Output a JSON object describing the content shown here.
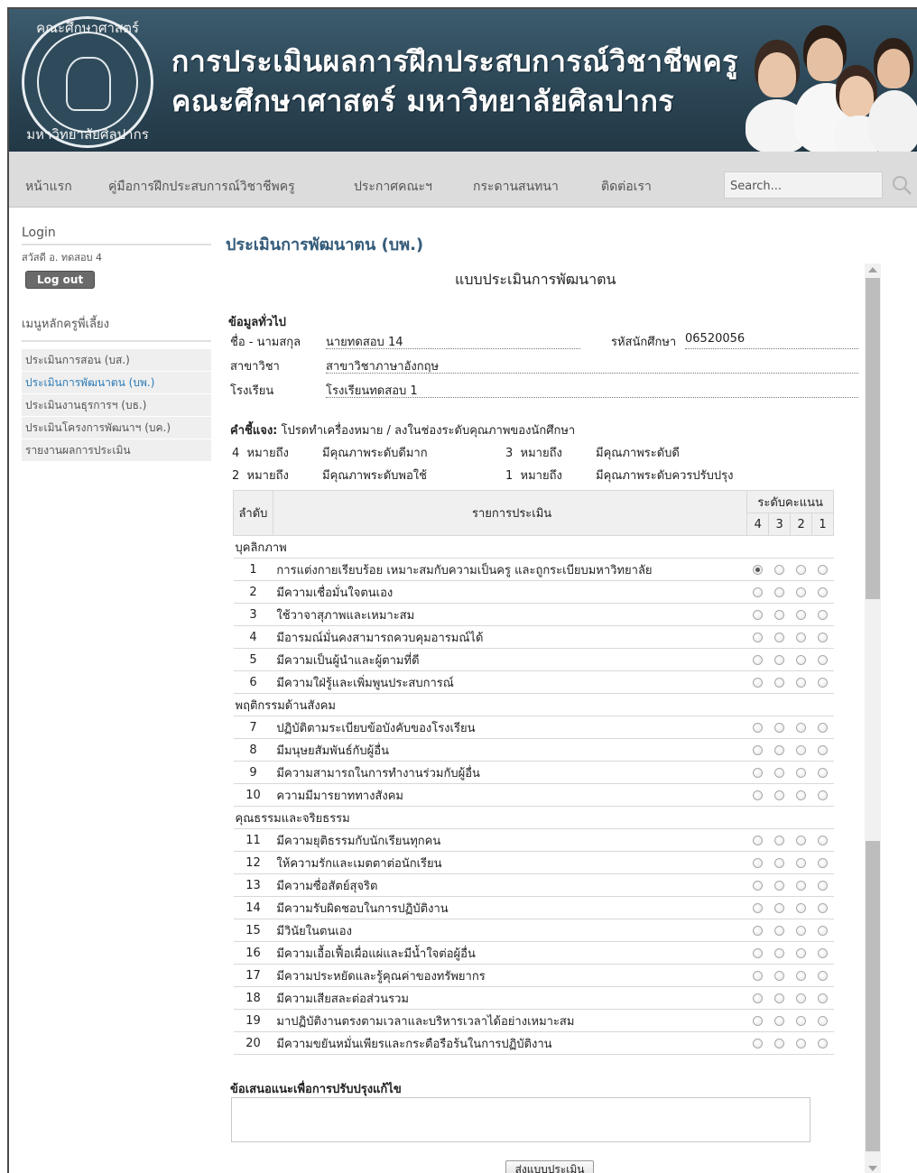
{
  "banner": {
    "line1": "การประเมินผลการฝึกประสบการณ์วิชาชีพครู",
    "line2": "คณะศึกษาศาสตร์ มหาวิทยาลัยศิลปากร",
    "seal_top": "คณะศึกษาศาสตร์",
    "seal_bottom": "มหาวิทยาลัยศิลปากร"
  },
  "nav": {
    "items": [
      "หน้าแรก",
      "คู่มือการฝึกประสบการณ์วิชาชีพครู",
      "ประกาศคณะฯ",
      "กระดานสนทนา",
      "ติดต่อเรา"
    ],
    "search_placeholder": "Search..."
  },
  "sidebar": {
    "login_heading": "Login",
    "greeting": "สวัสดี อ. ทดสอบ 4",
    "logout": "Log out",
    "menu_heading": "เมนูหลักครูพี่เลี้ยง",
    "menu": [
      "ประเมินการสอน (บส.)",
      "ประเมินการพัฒนาตน (บพ.)",
      "ประเมินงานธุรการฯ (บธ.)",
      "ประเมินโครงการพัฒนาฯ (บค.)",
      "รายงานผลการประเมิน"
    ]
  },
  "main": {
    "title": "ประเมินการพัฒนาตน (บพ.)",
    "form_title": "แบบประเมินการพัฒนาตน",
    "general_heading": "ข้อมูลทั่วไป",
    "name_label": "ชื่อ - นามสกุล",
    "name_value": "นายทดสอบ 14",
    "student_id_label": "รหัสนักศึกษา",
    "student_id_value": "06520056",
    "major_label": "สาขาวิชา",
    "major_value": "สาขาวิชาภาษาอังกฤษ",
    "school_label": "โรงเรียน",
    "school_value": "โรงเรียนทดสอบ 1",
    "instruction_bold": "คำชี้แจง:",
    "instruction_text": " โปรดทำเครื่องหมาย / ลงในช่องระดับคุณภาพของนักศึกษา",
    "legend": [
      {
        "num": "4",
        "means": "หมายถึง",
        "desc": "มีคุณภาพระดับดีมาก"
      },
      {
        "num": "3",
        "means": "หมายถึง",
        "desc": "มีคุณภาพระดับดี"
      },
      {
        "num": "2",
        "means": "หมายถึง",
        "desc": "มีคุณภาพระดับพอใช้"
      },
      {
        "num": "1",
        "means": "หมายถึง",
        "desc": "มีคุณภาพระดับควรปรับปรุง"
      }
    ],
    "table": {
      "col_order": "ลำดับ",
      "col_item": "รายการประเมิน",
      "col_score": "ระดับคะแนน",
      "scores": [
        "4",
        "3",
        "2",
        "1"
      ]
    },
    "suggest_label": "ข้อเสนอแนะเพื่อการปรับปรุงแก้ไข",
    "suggest_value": "",
    "submit": "ส่งแบบประเมิน"
  },
  "categories": [
    {
      "name": "บุคลิกภาพ",
      "items": [
        {
          "n": "1",
          "text": "การแต่งกายเรียบร้อย เหมาะสมกับความเป็นครู และถูกระเบียบมหาวิทยาลัย",
          "selected": 4
        },
        {
          "n": "2",
          "text": "มีความเชื่อมั่นใจตนเอง",
          "selected": 0
        },
        {
          "n": "3",
          "text": "ใช้วาจาสุภาพและเหมาะสม",
          "selected": 0
        },
        {
          "n": "4",
          "text": "มีอารมณ์มั่นคงสามารถควบคุมอารมณ์ได้",
          "selected": 0
        },
        {
          "n": "5",
          "text": "มีความเป็นผู้นำและผู้ตามที่ดี",
          "selected": 0
        },
        {
          "n": "6",
          "text": "มีความใฝ่รู้และเพิ่มพูนประสบการณ์",
          "selected": 0
        }
      ]
    },
    {
      "name": "พฤติกรรมด้านสังคม",
      "items": [
        {
          "n": "7",
          "text": "ปฏิบัติตามระเบียบข้อบังคับของโรงเรียน",
          "selected": 0
        },
        {
          "n": "8",
          "text": "มีมนุษยสัมพันธ์กับผู้อื่น",
          "selected": 0
        },
        {
          "n": "9",
          "text": "มีความสามารถในการทำงานร่วมกับผู้อื่น",
          "selected": 0
        },
        {
          "n": "10",
          "text": "ความมีมารยาททางสังคม",
          "selected": 0
        }
      ]
    },
    {
      "name": "คุณธรรมและจริยธรรม",
      "items": [
        {
          "n": "11",
          "text": "มีความยุติธรรมกับนักเรียนทุกคน",
          "selected": 0
        },
        {
          "n": "12",
          "text": "ให้ความรักและเมตตาต่อนักเรียน",
          "selected": 0
        },
        {
          "n": "13",
          "text": "มีความซื่อสัตย์สุจริต",
          "selected": 0
        },
        {
          "n": "14",
          "text": "มีความรับผิดชอบในการปฏิบัติงาน",
          "selected": 0
        },
        {
          "n": "15",
          "text": "มีวินัยในตนเอง",
          "selected": 0
        },
        {
          "n": "16",
          "text": "มีความเอื้อเฟื้อเผื่อแผ่และมีน้ำใจต่อผู้อื่น",
          "selected": 0
        },
        {
          "n": "17",
          "text": "มีความประหยัดและรู้คุณค่าของทรัพยากร",
          "selected": 0
        },
        {
          "n": "18",
          "text": "มีความเสียสละต่อส่วนรวม",
          "selected": 0
        },
        {
          "n": "19",
          "text": "มาปฏิบัติงานตรงตามเวลาและบริหารเวลาได้อย่างเหมาะสม",
          "selected": 0
        },
        {
          "n": "20",
          "text": "มีความขยันหมั่นเพียรและกระตือรือร้นในการปฏิบัติงาน",
          "selected": 0
        }
      ]
    }
  ]
}
